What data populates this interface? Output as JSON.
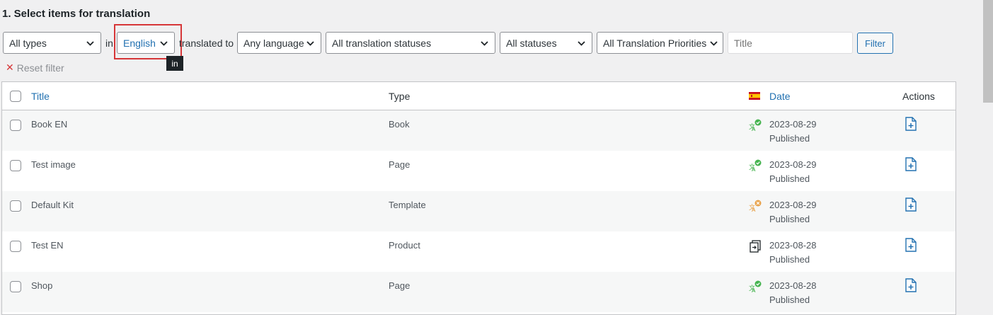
{
  "section_title": "1. Select items for translation",
  "filters": {
    "type": "All types",
    "in_label": "in",
    "source_language": "English",
    "translated_to_label": "translated to",
    "target_language": "Any language",
    "translation_status": "All translation statuses",
    "status": "All statuses",
    "priority": "All Translation Priorities",
    "title_placeholder": "Title",
    "filter_button": "Filter",
    "reset_label": "Reset filter",
    "tooltip": "in"
  },
  "table": {
    "headers": {
      "title": "Title",
      "type": "Type",
      "date": "Date",
      "actions": "Actions"
    },
    "rows": [
      {
        "title": "Book EN",
        "type": "Book",
        "date": "2023-08-29",
        "status": "Published",
        "icon": "translated-complete"
      },
      {
        "title": "Test image",
        "type": "Page",
        "date": "2023-08-29",
        "status": "Published",
        "icon": "translated-complete"
      },
      {
        "title": "Default Kit",
        "type": "Template",
        "date": "2023-08-29",
        "status": "Published",
        "icon": "translated-needs-update"
      },
      {
        "title": "Test EN",
        "type": "Product",
        "date": "2023-08-28",
        "status": "Published",
        "icon": "duplicate"
      },
      {
        "title": "Shop",
        "type": "Page",
        "date": "2023-08-28",
        "status": "Published",
        "icon": "translated-complete"
      }
    ]
  },
  "colors": {
    "link": "#2271b1",
    "highlight": "#d63638",
    "complete": "#46b450",
    "needs_update": "#e8a24a"
  }
}
